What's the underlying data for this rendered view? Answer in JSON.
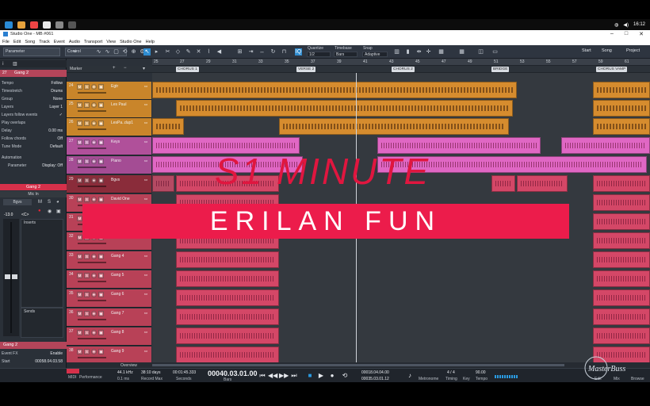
{
  "window": {
    "title": "Studio One - MB #061",
    "controls": [
      "–",
      "□",
      "✕"
    ]
  },
  "taskbar": {
    "clock": "16:12"
  },
  "menu": [
    "File",
    "Edit",
    "Song",
    "Track",
    "Event",
    "Audio",
    "Transport",
    "View",
    "Studio One",
    "Help"
  ],
  "toolbar": {
    "parameter_label": "Parameter",
    "control_label": "Control",
    "quantize_label": "Quantize",
    "quantize_value": "1/2",
    "timebase_label": "Timebase",
    "timebase_value": "Bars",
    "snap_label": "Snap",
    "snap_value": "Adaptive",
    "start": "Start",
    "song": "Song",
    "project": "Project"
  },
  "inspector": {
    "track_name": "Gang 2",
    "track_num": "27",
    "rows": [
      {
        "label": "Tempo",
        "value": "Follow"
      },
      {
        "label": "Timestretch",
        "value": "Drums"
      },
      {
        "label": "Group",
        "value": "None"
      },
      {
        "label": "Layers",
        "value": "Layer 1"
      },
      {
        "label": "Layers follow events",
        "value": "✓"
      },
      {
        "label": "Play overlaps",
        "value": ""
      },
      {
        "label": "Delay",
        "value": "0.00 ms"
      },
      {
        "label": "Follow chords",
        "value": "Off"
      },
      {
        "label": "Tune Mode",
        "value": "Default"
      }
    ],
    "automation_label": "Automation",
    "parameter_label": "Parameter",
    "display_label": "Display: Off",
    "channel_bar": "Gang 2",
    "input": "Mic In",
    "output": "Bgvs",
    "fader_value": "-13.0",
    "pan_value": "<C>",
    "inserts": "Inserts",
    "sends": "Sends",
    "bottom_name": "Gang 2",
    "event_fx": "Event FX",
    "enable": "Enable",
    "start_label": "Start",
    "start_value": "00058.04.03.58"
  },
  "tracklist": {
    "header": "Marker",
    "tracks": [
      {
        "num": "24",
        "name": "Egtr",
        "color": "#c9852a"
      },
      {
        "num": "25",
        "name": "Les Paul",
        "color": "#c9852a"
      },
      {
        "num": "26",
        "name": "LesPa..dup1",
        "color": "#c9852a"
      },
      {
        "num": "27",
        "name": "Keys",
        "color": "#b0509a"
      },
      {
        "num": "28",
        "name": "Piano",
        "color": "#a44c94"
      },
      {
        "num": "29",
        "name": "Bgvs",
        "color": "#8a2c3a"
      },
      {
        "num": "30",
        "name": "David One",
        "color": "#b84157"
      },
      {
        "num": "31",
        "name": "",
        "color": "#b84157"
      },
      {
        "num": "32",
        "name": "",
        "color": "#b84157"
      },
      {
        "num": "33",
        "name": "Gang 4",
        "color": "#b84157"
      },
      {
        "num": "34",
        "name": "Gang 5",
        "color": "#b84157"
      },
      {
        "num": "35",
        "name": "Gang 6",
        "color": "#b84157"
      },
      {
        "num": "36",
        "name": "Gang 7",
        "color": "#b84157"
      },
      {
        "num": "37",
        "name": "Gang 8",
        "color": "#b84157"
      },
      {
        "num": "38",
        "name": "Gang 9",
        "color": "#b84157"
      }
    ]
  },
  "ruler": [
    "25",
    "27",
    "29",
    "31",
    "33",
    "35",
    "37",
    "39",
    "41",
    "43",
    "45",
    "47",
    "49",
    "51",
    "53",
    "55",
    "57",
    "59",
    "61"
  ],
  "markers": [
    "CHORUS 1",
    "VERSE 2",
    "CHORUS 2",
    "BRIDGE",
    "CHORUS VAMP"
  ],
  "overlay": {
    "title": "S1 MINUTE",
    "subtitle": "ERILAN FUN"
  },
  "transport": {
    "midi": "MIDI",
    "performance": "Performance",
    "sample_rate": "44.1 kHz",
    "latency": "0.1 ms",
    "record_time": "38:10 days",
    "record_max": "Record Max",
    "seconds_value": "00:01:45.333",
    "seconds_label": "Seconds",
    "bars_value": "00040.03.01.00",
    "bars_label": "Bars",
    "loop_l": "00018.04.04.00",
    "loop_r": "00035.03.01.12",
    "metronome": "Metronome",
    "timing": "Timing",
    "signature": "4 / 4",
    "key": "Key",
    "tempo_value": "90.00",
    "tempo_label": "Tempo",
    "edit": "Edit",
    "mix": "Mix",
    "browse": "Browse",
    "overview": "Overview"
  },
  "logo": {
    "text": "MasterBuss"
  }
}
